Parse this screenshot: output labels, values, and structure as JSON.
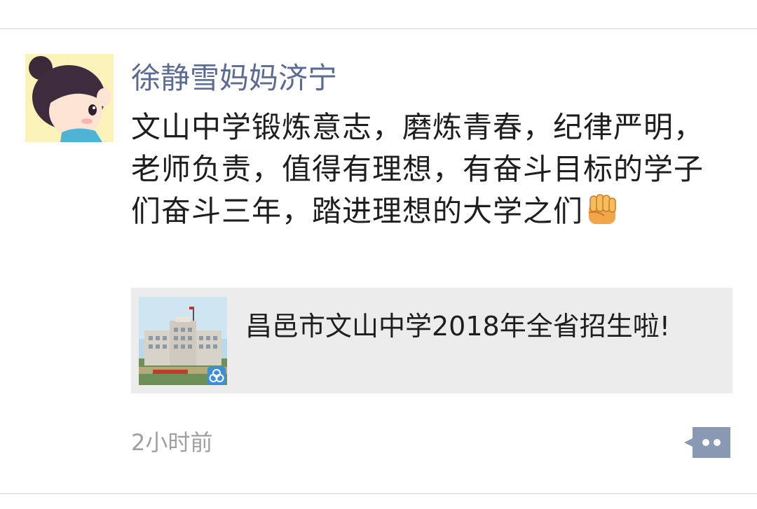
{
  "post": {
    "author": "徐静雪妈妈济宁",
    "text": "文山中学锻炼意志，磨炼青春，纪律严明，老师负责，值得有理想，有奋斗目标的学子们奋斗三年，踏进理想的大学之们",
    "emoji": "fist-emoji",
    "timestamp": "2小时前"
  },
  "link_card": {
    "title": "昌邑市文山中学2018年全省招生啦!",
    "thumb_icon": "building-photo"
  },
  "icons": {
    "comment": "comment-bubble-icon",
    "mini_program": "mini-program-icon"
  },
  "colors": {
    "author_name": "#5b6b93",
    "card_background": "#ececec",
    "timestamp": "#a0a0a0",
    "comment_button": "#8a99b3"
  }
}
